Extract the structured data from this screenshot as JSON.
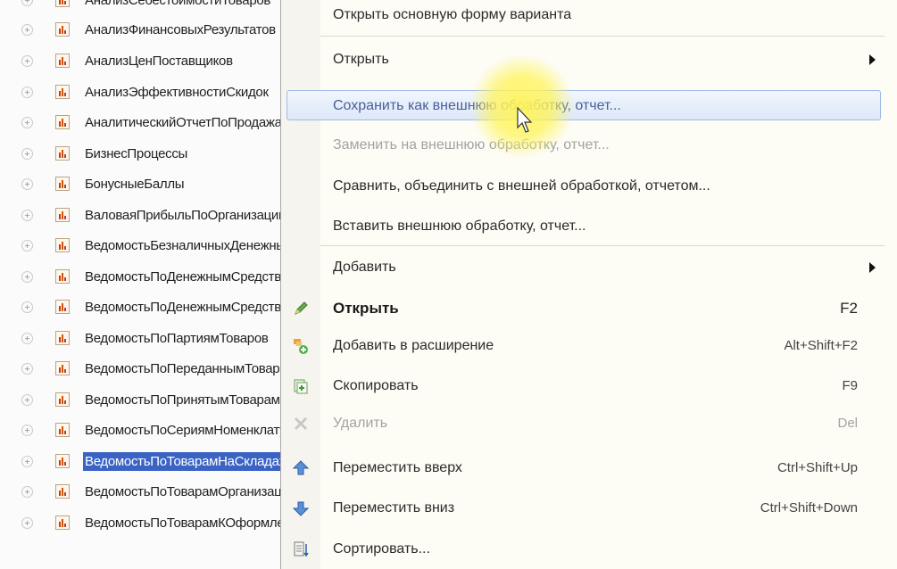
{
  "tree": {
    "items": [
      {
        "label": "АнализСебестоимостиТоваров",
        "selected": false
      },
      {
        "label": "АнализФинансовыхРезультатов",
        "selected": false
      },
      {
        "label": "АнализЦенПоставщиков",
        "selected": false
      },
      {
        "label": "АнализЭффективностиСкидок",
        "selected": false
      },
      {
        "label": "АналитическийОтчетПоПродажам",
        "selected": false
      },
      {
        "label": "БизнесПроцессы",
        "selected": false
      },
      {
        "label": "БонусныеБаллы",
        "selected": false
      },
      {
        "label": "ВаловаяПрибыльПоОрганизации",
        "selected": false
      },
      {
        "label": "ВедомостьБезналичныхДенежныхСредств",
        "selected": false
      },
      {
        "label": "ВедомостьПоДенежнымСредствам",
        "selected": false
      },
      {
        "label": "ВедомостьПоДенежнымСредствамВКассах",
        "selected": false
      },
      {
        "label": "ВедомостьПоПартиямТоваров",
        "selected": false
      },
      {
        "label": "ВедомостьПоПереданнымТоварам",
        "selected": false
      },
      {
        "label": "ВедомостьПоПринятымТоварам",
        "selected": false
      },
      {
        "label": "ВедомостьПоСериямНоменклатуры",
        "selected": false
      },
      {
        "label": "ВедомостьПоТоварамНаСкладах",
        "selected": true
      },
      {
        "label": "ВедомостьПоТоварамОрганизаций",
        "selected": false
      },
      {
        "label": "ВедомостьПоТоварамКОформлению",
        "selected": false
      }
    ],
    "colors": {
      "selection": "#3b63c4"
    }
  },
  "menu": {
    "items": [
      {
        "label": "Открыть основную форму варианта",
        "shortcut": "",
        "icon": "",
        "disabled": false,
        "bold": false,
        "submenu": false,
        "highlighted": false
      },
      {
        "label": "Открыть",
        "shortcut": "",
        "icon": "",
        "disabled": false,
        "bold": false,
        "submenu": true,
        "highlighted": false
      },
      {
        "label": "Сохранить как внешнюю обработку, отчет...",
        "shortcut": "",
        "icon": "",
        "disabled": false,
        "bold": false,
        "submenu": false,
        "highlighted": true
      },
      {
        "label": "Заменить на внешнюю обработку, отчет...",
        "shortcut": "",
        "icon": "",
        "disabled": true,
        "bold": false,
        "submenu": false,
        "highlighted": false
      },
      {
        "label": "Сравнить, объединить с внешней обработкой, отчетом...",
        "shortcut": "",
        "icon": "",
        "disabled": false,
        "bold": false,
        "submenu": false,
        "highlighted": false
      },
      {
        "label": "Вставить внешнюю обработку, отчет...",
        "shortcut": "",
        "icon": "",
        "disabled": false,
        "bold": false,
        "submenu": false,
        "highlighted": false
      },
      {
        "label": "Добавить",
        "shortcut": "",
        "icon": "",
        "disabled": false,
        "bold": false,
        "submenu": true,
        "highlighted": false
      },
      {
        "label": "Открыть",
        "shortcut": "F2",
        "icon": "pencil-icon",
        "disabled": false,
        "bold": true,
        "submenu": false,
        "highlighted": false
      },
      {
        "label": "Добавить в расширение",
        "shortcut": "Alt+Shift+F2",
        "icon": "add-to-extension-icon",
        "disabled": false,
        "bold": false,
        "submenu": false,
        "highlighted": false
      },
      {
        "label": "Скопировать",
        "shortcut": "F9",
        "icon": "copy-icon",
        "disabled": false,
        "bold": false,
        "submenu": false,
        "highlighted": false
      },
      {
        "label": "Удалить",
        "shortcut": "Del",
        "icon": "delete-icon",
        "disabled": true,
        "bold": false,
        "submenu": false,
        "highlighted": false
      },
      {
        "label": "Переместить вверх",
        "shortcut": "Ctrl+Shift+Up",
        "icon": "move-up-icon",
        "disabled": false,
        "bold": false,
        "submenu": false,
        "highlighted": false
      },
      {
        "label": "Переместить вниз",
        "shortcut": "Ctrl+Shift+Down",
        "icon": "move-down-icon",
        "disabled": false,
        "bold": false,
        "submenu": false,
        "highlighted": false
      },
      {
        "label": "Сортировать...",
        "shortcut": "",
        "icon": "sort-icon",
        "disabled": false,
        "bold": false,
        "submenu": false,
        "highlighted": false
      }
    ],
    "colors": {
      "highlight_border": "#9fbbe6",
      "disabled_text": "#a3a3a3"
    }
  }
}
